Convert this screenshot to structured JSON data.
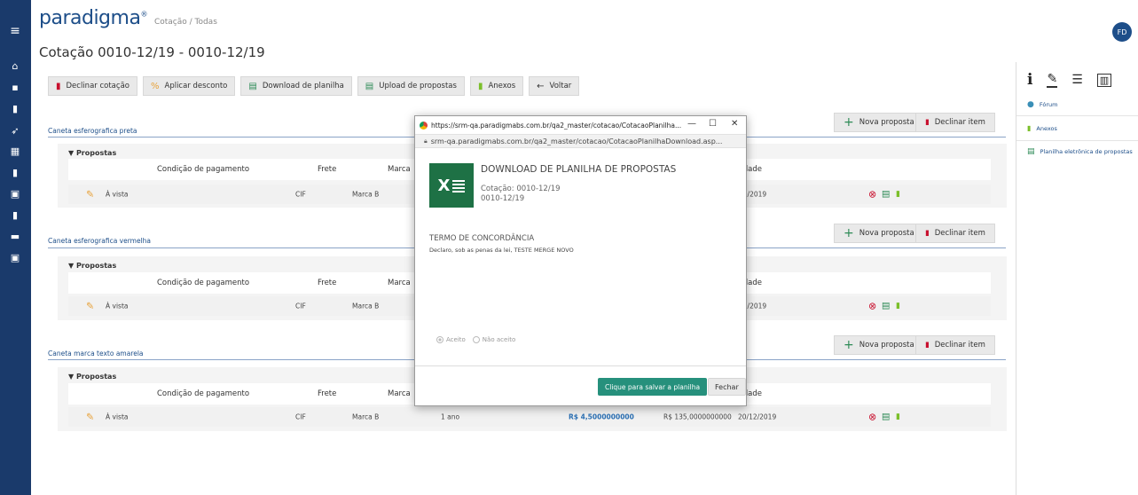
{
  "header": {
    "logo": "paradigma",
    "logo_mark": "®",
    "breadcrumb": "Cotação / Todas",
    "page_title": "Cotação 0010-12/19 - 0010-12/19",
    "avatar_initials": "FD"
  },
  "nav_icons": [
    "menu-icon",
    "home-icon",
    "message-icon",
    "document-icon",
    "gavel-icon",
    "grid-icon",
    "phone-icon",
    "calculator-icon",
    "report-icon",
    "card-icon",
    "settings-icon"
  ],
  "toolbar": {
    "decline": "Declinar cotação",
    "discount": "Aplicar desconto",
    "download": "Download de planilha",
    "upload": "Upload de propostas",
    "attachments": "Anexos",
    "back": "Voltar"
  },
  "item_actions": {
    "new_proposal": "Nova proposta",
    "decline_item": "Declinar item"
  },
  "proposals_label": "▼ Propostas",
  "columns": {
    "payment": "Condição de pagamento",
    "freight": "Frete",
    "brand": "Marca",
    "validity": "lidade"
  },
  "items": [
    {
      "title": "Caneta esferografica preta",
      "row": {
        "payment": "À vista",
        "freight": "CIF",
        "brand": "Marca B",
        "date": "12/2019"
      }
    },
    {
      "title": "Caneta esferografica vermelha",
      "row": {
        "payment": "À vista",
        "freight": "CIF",
        "brand": "Marca B",
        "date": "12/2019"
      }
    },
    {
      "title": "Caneta marca texto amarela",
      "row": {
        "payment": "À vista",
        "freight": "CIF",
        "brand": "Marca B",
        "warranty": "1 ano",
        "unit_price": "R$ 4,5000000000",
        "total": "R$ 135,0000000000",
        "date": "20/12/2019"
      }
    }
  ],
  "right_panel": {
    "forum": "Fórum",
    "attachments": "Anexos",
    "spreadsheet": "Planilha eletrônica de propostas"
  },
  "modal": {
    "window_title": "https://srm-qa.paradigmabs.com.br/qa2_master/cotacao/CotacaoPlanilha...",
    "url": "srm-qa.paradigmabs.com.br/qa2_master/cotacao/CotacaoPlanilhaDownload.asp...",
    "heading": "DOWNLOAD DE PLANILHA DE PROPOSTAS",
    "quote_line": "Cotação: 0010-12/19",
    "quote_code": "0010-12/19",
    "term_title": "TERMO DE CONCORDÂNCIA",
    "declaration": "Declaro, sob as penas da lei, TESTE MERGE NOVO",
    "accept": "Aceito",
    "not_accept": "Não aceito",
    "save_button": "Clique para salvar a planilha",
    "close_button": "Fechar",
    "minimize": "—",
    "maximize": "☐",
    "close_x": "✕"
  }
}
